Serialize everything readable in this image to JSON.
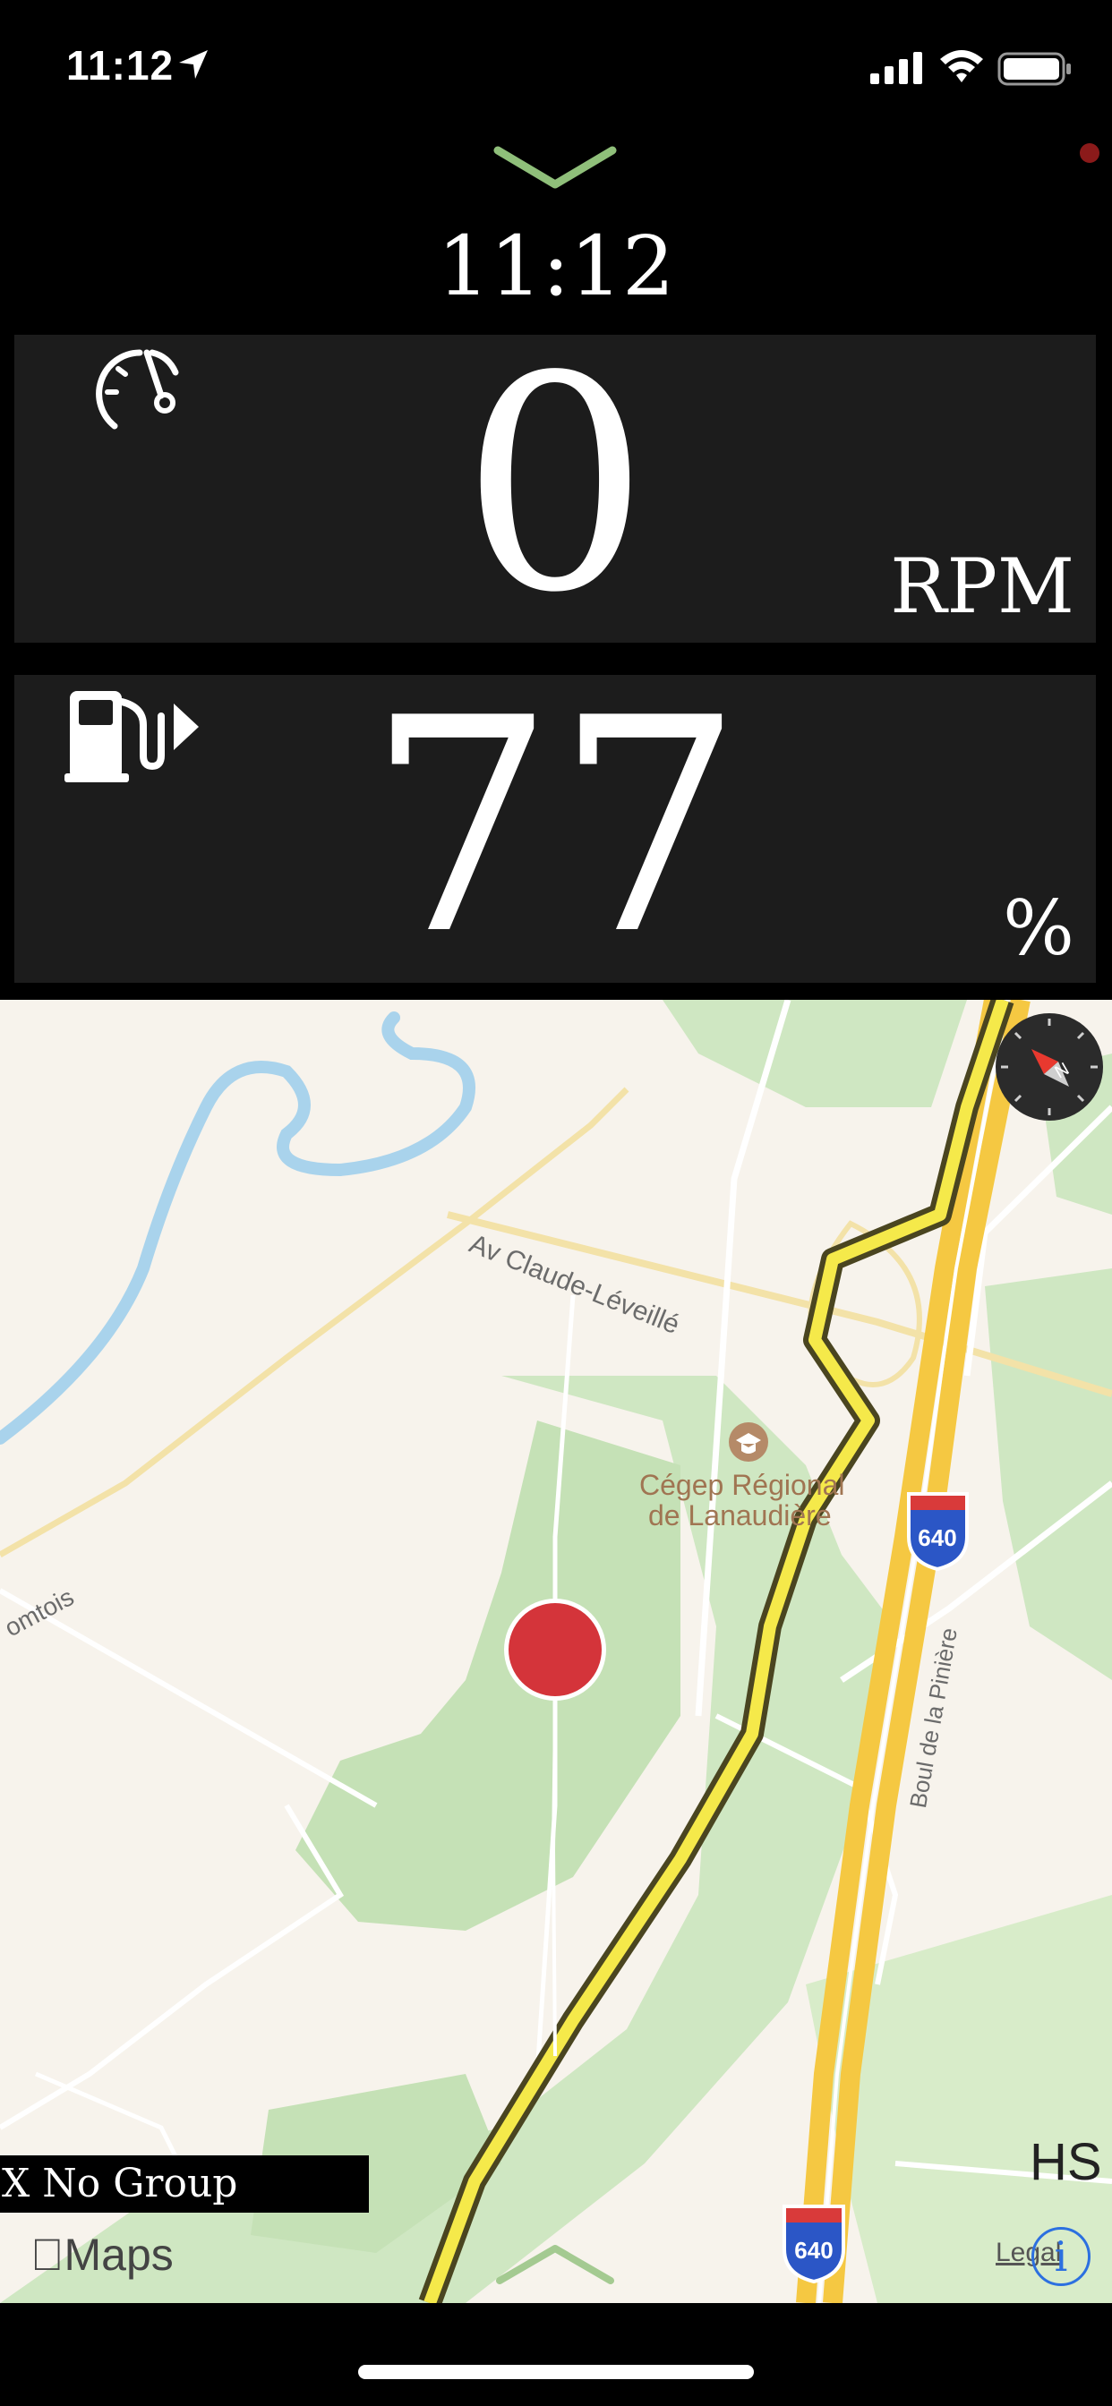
{
  "status_bar": {
    "time": "11:12"
  },
  "dashboard": {
    "clock": "11:12",
    "rpm": {
      "value": "0",
      "unit": "RPM"
    },
    "fuel": {
      "value": "77",
      "unit": "%"
    }
  },
  "map": {
    "labels": {
      "road_claude": "Av Claude-Léveillé",
      "school_line1": "Cégep Régional",
      "school_line2": "de Lanaudière",
      "road_piniere": "Boul de la Pinière",
      "road_comtois": "omtois",
      "shield_640_a": "640",
      "shield_640_b": "640"
    },
    "group_label": "X No Group",
    "maps_logo": "Maps",
    "hs": "HS",
    "legal": "Legal",
    "info": "i"
  },
  "colors": {
    "accent_chevron": "#8fbf7a",
    "panel": "#1c1c1c",
    "route": "#f5e94a",
    "pin": "#d4343a"
  },
  "icons": [
    "location-arrow-icon",
    "signal-icon",
    "wifi-icon",
    "battery-icon",
    "chevron-down-icon",
    "speedometer-icon",
    "fuel-pump-icon",
    "compass-icon",
    "apple-logo-icon",
    "info-icon",
    "chevron-up-icon"
  ]
}
